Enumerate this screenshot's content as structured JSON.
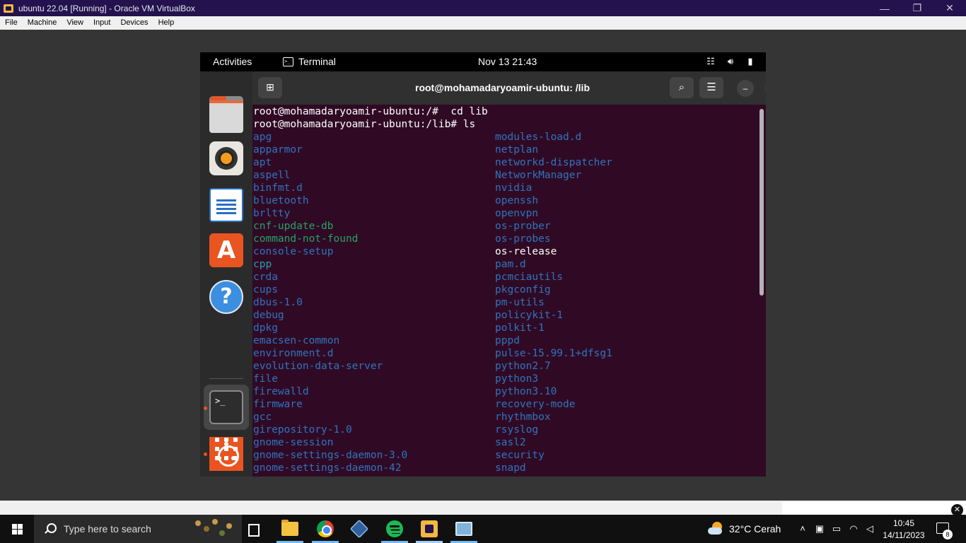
{
  "host": {
    "title": "ubuntu 22.04 [Running] - Oracle VM VirtualBox",
    "menu": [
      "File",
      "Machine",
      "View",
      "Input",
      "Devices",
      "Help"
    ],
    "controls": {
      "minimize": "—",
      "restore": "❐",
      "close": "✕"
    }
  },
  "gnome": {
    "activities": "Activities",
    "app_name": "Terminal",
    "clock": "Nov 13  21:43",
    "tray_icons": [
      "network-icon",
      "volume-icon",
      "battery-icon"
    ]
  },
  "dock": {
    "apps": [
      "files-icon",
      "rhythmbox-icon",
      "libreoffice-writer-icon",
      "ubuntu-software-icon",
      "help-icon",
      "terminal-icon",
      "ubuntu-icon",
      "show-apps-icon"
    ]
  },
  "terminal": {
    "window_title": "root@mohamadaryoamir-ubuntu: /lib",
    "lines": [
      "root@mohamadaryoamir-ubuntu:/#  cd lib",
      "root@mohamadaryoamir-ubuntu:/lib# ls"
    ],
    "col1": [
      {
        "name": "apg",
        "type": "dir"
      },
      {
        "name": "apparmor",
        "type": "dir"
      },
      {
        "name": "apt",
        "type": "dir"
      },
      {
        "name": "aspell",
        "type": "dir"
      },
      {
        "name": "binfmt.d",
        "type": "dir"
      },
      {
        "name": "bluetooth",
        "type": "dir"
      },
      {
        "name": "brltty",
        "type": "dir"
      },
      {
        "name": "cnf-update-db",
        "type": "exec"
      },
      {
        "name": "command-not-found",
        "type": "exec"
      },
      {
        "name": "console-setup",
        "type": "dir"
      },
      {
        "name": "cpp",
        "type": "link"
      },
      {
        "name": "crda",
        "type": "dir"
      },
      {
        "name": "cups",
        "type": "dir"
      },
      {
        "name": "dbus-1.0",
        "type": "dir"
      },
      {
        "name": "debug",
        "type": "dir"
      },
      {
        "name": "dpkg",
        "type": "dir"
      },
      {
        "name": "emacsen-common",
        "type": "dir"
      },
      {
        "name": "environment.d",
        "type": "dir"
      },
      {
        "name": "evolution-data-server",
        "type": "dir"
      },
      {
        "name": "file",
        "type": "dir"
      },
      {
        "name": "firewalld",
        "type": "dir"
      },
      {
        "name": "firmware",
        "type": "dir"
      },
      {
        "name": "gcc",
        "type": "dir"
      },
      {
        "name": "girepository-1.0",
        "type": "dir"
      },
      {
        "name": "gnome-session",
        "type": "dir"
      },
      {
        "name": "gnome-settings-daemon-3.0",
        "type": "dir"
      },
      {
        "name": "gnome-settings-daemon-42",
        "type": "dir"
      }
    ],
    "col2": [
      {
        "name": "modules-load.d",
        "type": "dir"
      },
      {
        "name": "netplan",
        "type": "dir"
      },
      {
        "name": "networkd-dispatcher",
        "type": "dir"
      },
      {
        "name": "NetworkManager",
        "type": "dir"
      },
      {
        "name": "nvidia",
        "type": "dir"
      },
      {
        "name": "openssh",
        "type": "dir"
      },
      {
        "name": "openvpn",
        "type": "dir"
      },
      {
        "name": "os-prober",
        "type": "dir"
      },
      {
        "name": "os-probes",
        "type": "dir"
      },
      {
        "name": "os-release",
        "type": "file"
      },
      {
        "name": "pam.d",
        "type": "dir"
      },
      {
        "name": "pcmciautils",
        "type": "dir"
      },
      {
        "name": "pkgconfig",
        "type": "dir"
      },
      {
        "name": "pm-utils",
        "type": "dir"
      },
      {
        "name": "policykit-1",
        "type": "dir"
      },
      {
        "name": "polkit-1",
        "type": "dir"
      },
      {
        "name": "pppd",
        "type": "dir"
      },
      {
        "name": "pulse-15.99.1+dfsg1",
        "type": "dir"
      },
      {
        "name": "python2.7",
        "type": "dir"
      },
      {
        "name": "python3",
        "type": "dir"
      },
      {
        "name": "python3.10",
        "type": "dir"
      },
      {
        "name": "recovery-mode",
        "type": "dir"
      },
      {
        "name": "rhythmbox",
        "type": "dir"
      },
      {
        "name": "rsyslog",
        "type": "dir"
      },
      {
        "name": "sasl2",
        "type": "dir"
      },
      {
        "name": "security",
        "type": "dir"
      },
      {
        "name": "snapd",
        "type": "dir"
      }
    ],
    "colors": {
      "background": "#300a24",
      "dir": "#2f74c0",
      "link": "#2aa1b3",
      "exec": "#26a269",
      "file": "#ffffff"
    }
  },
  "taskbar": {
    "search_placeholder": "Type here to search",
    "apps": [
      "task-view-icon",
      "file-explorer-icon",
      "chrome-icon",
      "virtualbox-icon",
      "spotify-icon",
      "virtualbox-vm-icon",
      "photos-icon"
    ],
    "weather": "32°C  Cerah",
    "time": "10:45",
    "date": "14/11/2023",
    "notification_count": "8"
  }
}
